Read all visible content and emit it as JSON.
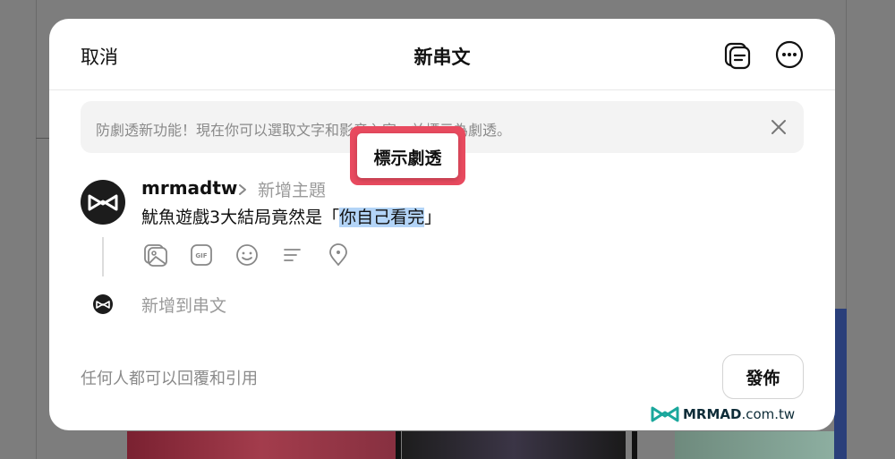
{
  "header": {
    "cancel_label": "取消",
    "title": "新串文",
    "draft_icon": "drafts-icon",
    "more_icon": "more-icon"
  },
  "notice": {
    "text": "防劇透新功能！現在你可以選取文字和影音內容，並標示為劇透。",
    "close_icon": "close-icon"
  },
  "composer": {
    "username": "mrmadtw",
    "topic_placeholder": "新增主題",
    "post_before": "魷魚遊戲3大結局竟然是「",
    "post_selected": "你自己看完",
    "post_after": "」",
    "tools": [
      "gallery-icon",
      "gif-icon",
      "emoji-icon",
      "poll-icon",
      "location-icon"
    ],
    "add_to_thread": "新增到串文"
  },
  "popup": {
    "label": "標示劇透",
    "highlight_color": "#e84a5f"
  },
  "footer": {
    "reply_permission": "任何人都可以回覆和引用",
    "publish_label": "發佈"
  },
  "watermark": {
    "brand": "MRMAD",
    "domain": ".com.tw"
  },
  "colors": {
    "selection": "#b3d4f7",
    "overlay": "#7d7d7d"
  }
}
